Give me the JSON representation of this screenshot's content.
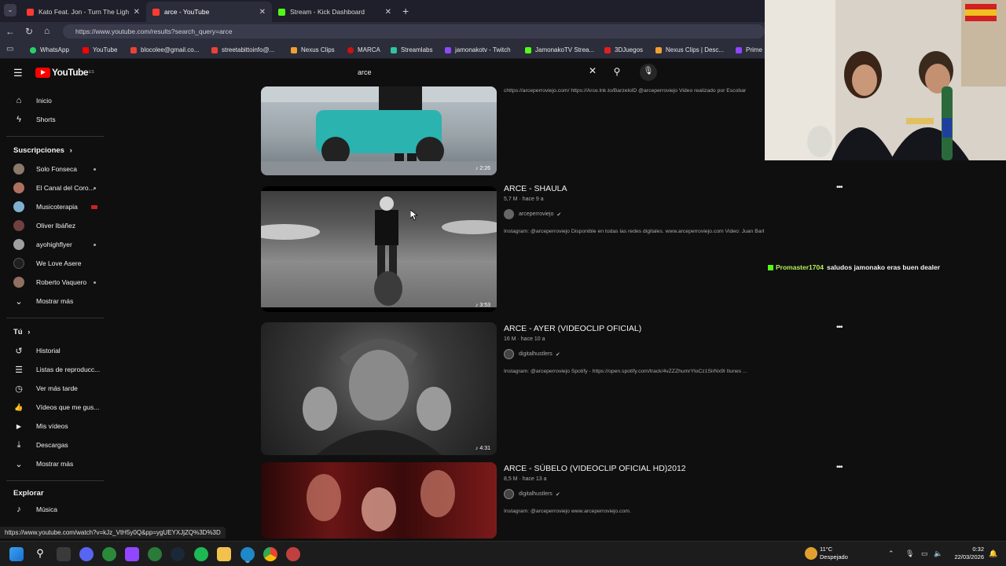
{
  "browser": {
    "tabs": [
      {
        "title": "Kato Feat. Jon - Turn The Lights Of",
        "color": "#ff3b30"
      },
      {
        "title": "arce - YouTube",
        "color": "#ff3b30"
      },
      {
        "title": "Stream - Kick Dashboard",
        "color": "#53fc18"
      }
    ],
    "url": "https://www.youtube.com/results?search_query=arce",
    "bookmarks": [
      {
        "label": "WhatsApp",
        "color": "#25d366"
      },
      {
        "label": "YouTube",
        "color": "#ff0000"
      },
      {
        "label": "blocolee@gmail.co...",
        "color": "#ea4335"
      },
      {
        "label": "streetabittoinfo@...",
        "color": "#ea4335"
      },
      {
        "label": "Nexus Clips",
        "color": "#f0a030"
      },
      {
        "label": "MARCA",
        "color": "#d01010"
      },
      {
        "label": "Streamlabs",
        "color": "#31c3a2"
      },
      {
        "label": "jamonakotv - Twitch",
        "color": "#9146ff"
      },
      {
        "label": "JamonakoTV Strea...",
        "color": "#53fc18"
      },
      {
        "label": "3DJuegos",
        "color": "#e02020"
      },
      {
        "label": "Nexus Clips | Desc...",
        "color": "#f0a030"
      },
      {
        "label": "Prime",
        "color": "#9146ff"
      }
    ]
  },
  "youtube": {
    "logo_text": "YouTube",
    "logo_region": "ES",
    "search_query": "arce",
    "sidebar": {
      "main": [
        {
          "label": "Inicio",
          "icon": "⌂"
        },
        {
          "label": "Shorts",
          "icon": "ϟ"
        }
      ],
      "subs_heading": "Suscripciones",
      "subs": [
        {
          "label": "Solo Fonseca",
          "color": "#8a7a6a"
        },
        {
          "label": "El Canal del Coro...",
          "color": "#b07060"
        },
        {
          "label": "Musicoterapia",
          "color": "#7fb0d0"
        },
        {
          "label": "Oliver Ibáñez",
          "color": "#704040"
        },
        {
          "label": "ayohighflyer",
          "color": "#a0a0a0"
        },
        {
          "label": "We Love Asere",
          "color": "#202020"
        },
        {
          "label": "Roberto Vaquero",
          "color": "#907060"
        }
      ],
      "show_more": "Mostrar más",
      "you_heading": "Tú",
      "you": [
        {
          "label": "Historial",
          "icon": "↺"
        },
        {
          "label": "Listas de reproducc...",
          "icon": "☰"
        },
        {
          "label": "Ver más tarde",
          "icon": "◷"
        },
        {
          "label": "Vídeos que me gus...",
          "icon": "👍"
        },
        {
          "label": "Mis vídeos",
          "icon": "▶"
        },
        {
          "label": "Descargas",
          "icon": "⤓"
        }
      ],
      "show_more_2": "Mostrar más",
      "explore_heading": "Explorar",
      "explore": [
        {
          "label": "Música",
          "icon": "♪"
        }
      ]
    },
    "results": [
      {
        "duration": "2:26",
        "desc": "chttps://arceperroviejo.com/ https://Arce.lnk.to/BarzelolD @arceperroviejo Video realizado por Escobar"
      },
      {
        "title": "ARCE - SHAULA",
        "meta": "5,7 M · hace 9 a",
        "channel": "arceperroviejo",
        "desc": "Instagram: @arceperroviejo Disponible en todas las redes digitales. www.arceperroviejo.com Video: Juan Barbazan.",
        "duration": "3:53"
      },
      {
        "title": "ARCE - AYER (VIDEOCLIP OFICIAL)",
        "meta": "16 M · hace 10 a",
        "channel": "digitalhustlers",
        "desc": "Instagram: @arceperroviejo Spotify - https://open.spotify.com/track/4vZZZhumrYloCz1SirNx9I Itunes ...",
        "duration": "4:31"
      },
      {
        "title": "ARCE - SÚBELO (VIDEOCLIP OFICIAL HD)2012",
        "meta": "8,5 M · hace 13 a",
        "channel": "digitalhustlers",
        "desc": "Instagram: @arceperroviejo www.arceperroviejo.com."
      }
    ],
    "more_icon": "•••",
    "status_url": "https://www.youtube.com/watch?v=kJz_VtH5y0Q&pp=ygUEYXJjZQ%3D%3D"
  },
  "chat": {
    "user": "Promaster1704",
    "message": "saludos jamonako eras buen dealer"
  },
  "taskbar": {
    "weather_temp": "11°C",
    "weather_desc": "Despejado",
    "time": "0:32",
    "date": "22/03/2026"
  }
}
